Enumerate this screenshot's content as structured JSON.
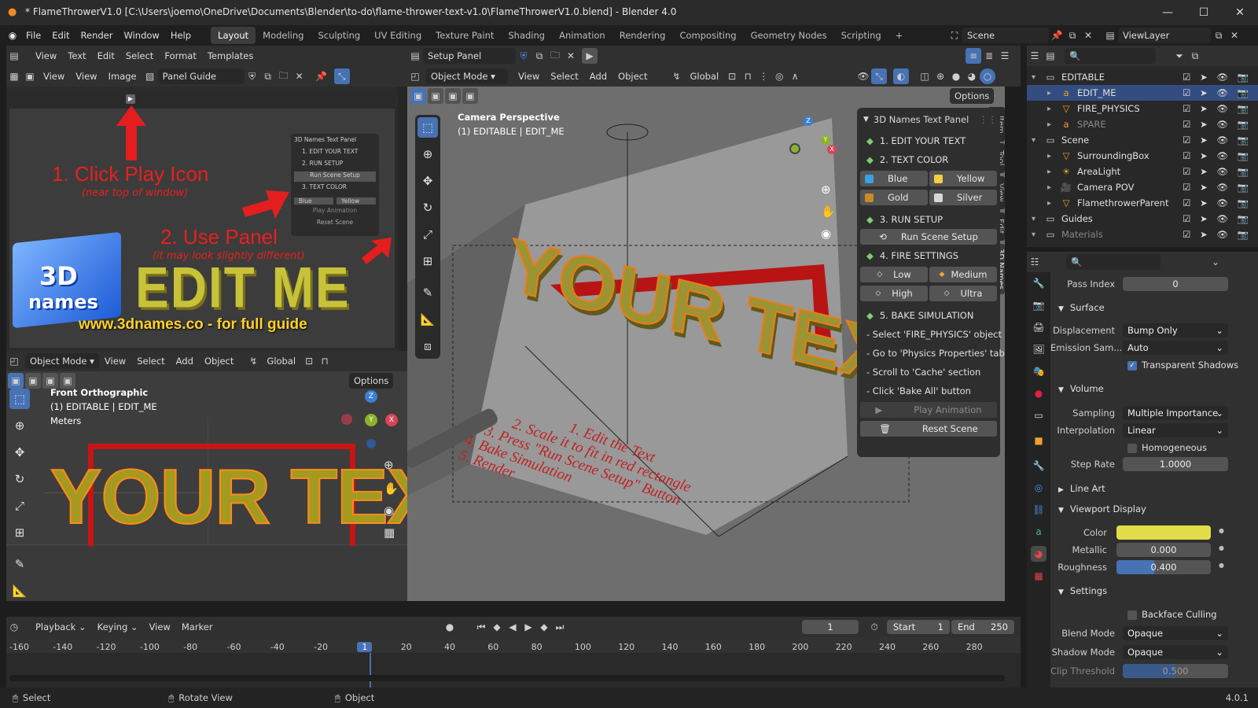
{
  "window": {
    "title": "* FlameThrowerV1.0 [C:\\Users\\joemo\\OneDrive\\Documents\\Blender\\to-do\\flame-thrower-text-v1.0\\FlameThrowerV1.0.blend] - Blender 4.0"
  },
  "menu": {
    "items": [
      "File",
      "Edit",
      "Render",
      "Window",
      "Help"
    ]
  },
  "workspaces": [
    "Layout",
    "Modeling",
    "Sculpting",
    "UV Editing",
    "Texture Paint",
    "Shading",
    "Animation",
    "Rendering",
    "Compositing",
    "Geometry Nodes",
    "Scripting"
  ],
  "scene": {
    "scene_name": "Scene",
    "view_layer": "ViewLayer"
  },
  "text_editor": {
    "menus": [
      "View",
      "Text",
      "Edit",
      "Select",
      "Format",
      "Templates"
    ],
    "file": "Setup Panel"
  },
  "image_editor": {
    "menus": [
      "View",
      "View",
      "Image"
    ],
    "image": "Panel Guide",
    "guide": {
      "step1": "1. Click Play Icon",
      "step1_sub": "(near top of window)",
      "step2": "2. Use Panel",
      "step2_sub": "(it may look slightly different)",
      "logo_line1": "3D",
      "logo_line2": "names",
      "big_text": "EDIT ME",
      "url": "www.3dnames.co - for full guide",
      "mini_panel": [
        "3D Names Text Panel",
        "1. EDIT YOUR TEXT",
        "2. RUN SETUP",
        "Run Scene Setup",
        "3. TEXT COLOR",
        "Blue",
        "Yellow",
        "Play Animation",
        "Reset Scene"
      ]
    }
  },
  "front_view": {
    "mode": "Object Mode",
    "menus": [
      "View",
      "Select",
      "Add",
      "Object"
    ],
    "orientation": "Global",
    "options": "Options",
    "overlay_title": "Front Orthographic",
    "overlay_obj": "(1) EDITABLE | EDIT_ME",
    "overlay_units": "Meters",
    "text": "YOUR TEXT"
  },
  "main_view": {
    "mode": "Object Mode",
    "menus": [
      "View",
      "Select",
      "Add",
      "Object"
    ],
    "orientation": "Global",
    "options": "Options",
    "overlay_title": "Camera Perspective",
    "overlay_obj": "(1) EDITABLE | EDIT_ME",
    "text": "YOUR TEXT",
    "floor_text": [
      "1. Edit the Text",
      "2. Scale it to fit in red rectangle",
      "3. Press \"Run Scene Setup\" Button",
      "4. Bake Simulation",
      "5. Render"
    ],
    "side_tabs": [
      "Item",
      "Tool",
      "View",
      "Edit",
      "3D Names"
    ]
  },
  "names_panel": {
    "title": "3D Names Text Panel",
    "s1": "1. EDIT YOUR TEXT",
    "s2": "2. TEXT COLOR",
    "colors": [
      {
        "label": "Blue",
        "hex": "#3aa0e0"
      },
      {
        "label": "Yellow",
        "hex": "#f0d040"
      },
      {
        "label": "Gold",
        "hex": "#c98a2a"
      },
      {
        "label": "Silver",
        "hex": "#d8d8d8"
      }
    ],
    "s3": "3. RUN SETUP",
    "run": "Run Scene Setup",
    "s4": "4. FIRE SETTINGS",
    "fire": [
      "Low",
      "Medium",
      "High",
      "Ultra"
    ],
    "s5": "5. BAKE SIMULATION",
    "bake_steps": [
      "- Select 'FIRE_PHYSICS' object",
      "- Go to 'Physics Properties' tab",
      "- Scroll to 'Cache' section",
      "- Click 'Bake All' button"
    ],
    "play": "Play Animation",
    "reset": "Reset Scene"
  },
  "outliner": {
    "items": [
      {
        "label": "EDITABLE",
        "level": 1,
        "type": "collection"
      },
      {
        "label": "EDIT_ME",
        "level": 2,
        "type": "text",
        "selected": true
      },
      {
        "label": "FIRE_PHYSICS",
        "level": 2,
        "type": "mesh"
      },
      {
        "label": "SPARE",
        "level": 2,
        "type": "text",
        "dim": true
      },
      {
        "label": "Scene",
        "level": 1,
        "type": "collection"
      },
      {
        "label": "SurroundingBox",
        "level": 2,
        "type": "mesh"
      },
      {
        "label": "AreaLight",
        "level": 2,
        "type": "light"
      },
      {
        "label": "Camera POV",
        "level": 2,
        "type": "camera"
      },
      {
        "label": "FlamethrowerParent",
        "level": 2,
        "type": "mesh"
      },
      {
        "label": "Guides",
        "level": 1,
        "type": "collection"
      },
      {
        "label": "Materials",
        "level": 1,
        "type": "collection",
        "dim": true
      }
    ]
  },
  "properties": {
    "pass_index": {
      "label": "Pass Index",
      "value": "0"
    },
    "surface": "Surface",
    "displacement": {
      "label": "Displacement",
      "value": "Bump Only"
    },
    "emission": {
      "label": "Emission Sam...",
      "value": "Auto"
    },
    "transparent_shadows": "Transparent Shadows",
    "volume": "Volume",
    "sampling": {
      "label": "Sampling",
      "value": "Multiple Importance"
    },
    "interpolation": {
      "label": "Interpolation",
      "value": "Linear"
    },
    "homogeneous": "Homogeneous",
    "step_rate": {
      "label": "Step Rate",
      "value": "1.0000"
    },
    "line_art": "Line Art",
    "viewport_display": "Viewport Display",
    "color": {
      "label": "Color",
      "hex": "#e3dc4a"
    },
    "metallic": {
      "label": "Metallic",
      "value": "0.000"
    },
    "roughness": {
      "label": "Roughness",
      "value": "0.400",
      "fill": 0.4
    },
    "settings": "Settings",
    "backface": "Backface Culling",
    "blend": {
      "label": "Blend Mode",
      "value": "Opaque"
    },
    "shadow": {
      "label": "Shadow Mode",
      "value": "Opaque"
    },
    "clip": {
      "label": "Clip Threshold",
      "value": "0.500",
      "fill": 0.5
    }
  },
  "timeline": {
    "menus": [
      "Playback",
      "Keying",
      "View",
      "Marker"
    ],
    "current": "1",
    "start_label": "Start",
    "start": "1",
    "end_label": "End",
    "end": "250",
    "ticks": [
      "-160",
      "-140",
      "-120",
      "-100",
      "-80",
      "-60",
      "-40",
      "-20",
      "1",
      "20",
      "40",
      "60",
      "80",
      "100",
      "120",
      "140",
      "160",
      "180",
      "200",
      "220",
      "240",
      "260",
      "280"
    ]
  },
  "status": {
    "select": "Select",
    "rotate": "Rotate View",
    "object": "Object",
    "version": "4.0.1"
  }
}
